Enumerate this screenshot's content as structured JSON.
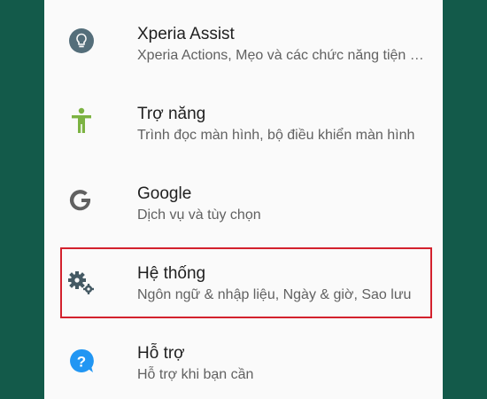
{
  "settings": {
    "items": [
      {
        "title": "Xperia Assist",
        "subtitle": "Xperia Actions, Mẹo và các chức năng tiện ích",
        "icon": "lightbulb-icon"
      },
      {
        "title": "Trợ năng",
        "subtitle": "Trình đọc màn hình, bộ điều khiển màn hình",
        "icon": "accessibility-icon"
      },
      {
        "title": "Google",
        "subtitle": "Dịch vụ và tùy chọn",
        "icon": "google-icon"
      },
      {
        "title": "Hệ thống",
        "subtitle": "Ngôn ngữ & nhập liệu, Ngày & giờ, Sao lưu",
        "icon": "gears-icon"
      },
      {
        "title": "Hỗ trợ",
        "subtitle": "Hỗ trợ khi bạn cần",
        "icon": "help-icon"
      }
    ]
  },
  "colors": {
    "background": "#135a4a",
    "panel": "#fafafa",
    "title": "#212121",
    "subtitle": "#616161",
    "highlight": "#d3212d",
    "accessibility_green": "#7cb342",
    "help_blue": "#2196f3",
    "icon_gray": "#546e7a"
  }
}
